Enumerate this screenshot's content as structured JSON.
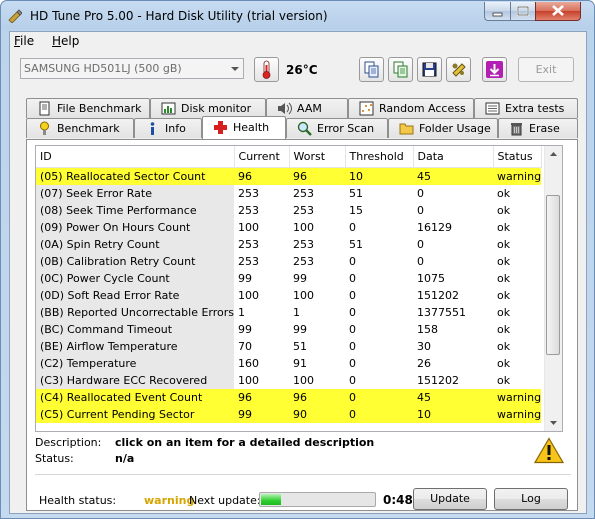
{
  "window": {
    "title": "HD Tune Pro 5.00 - Hard Disk Utility (trial version)"
  },
  "menu": [
    {
      "accel": "F",
      "rest": "ile"
    },
    {
      "accel": "H",
      "rest": "elp"
    }
  ],
  "toolbar": {
    "drive": "SAMSUNG HD501LJ (500 gB)",
    "temperature": "26°C",
    "exit_label": "Exit",
    "icons": [
      "copy-icon",
      "copy-all-icon",
      "save-icon",
      "options-icon",
      "download-icon"
    ]
  },
  "tabs_top": [
    {
      "label": "File Benchmark",
      "icon": "file-benchmark-icon"
    },
    {
      "label": "Disk monitor",
      "icon": "disk-monitor-icon"
    },
    {
      "label": "AAM",
      "icon": "speaker-icon"
    },
    {
      "label": "Random Access",
      "icon": "random-access-icon"
    },
    {
      "label": "Extra tests",
      "icon": "extra-tests-icon"
    }
  ],
  "tabs_bottom": [
    {
      "label": "Benchmark",
      "icon": "benchmark-icon"
    },
    {
      "label": "Info",
      "icon": "info-icon"
    },
    {
      "label": "Health",
      "icon": "health-cross-icon",
      "active": true
    },
    {
      "label": "Error Scan",
      "icon": "error-scan-icon"
    },
    {
      "label": "Folder Usage",
      "icon": "folder-icon"
    },
    {
      "label": "Erase",
      "icon": "trash-icon"
    }
  ],
  "smart": {
    "columns": [
      "ID",
      "Current",
      "Worst",
      "Threshold",
      "Data",
      "Status"
    ],
    "rows": [
      {
        "id": "(05) Reallocated Sector Count",
        "current": "96",
        "worst": "96",
        "threshold": "10",
        "data": "45",
        "status": "warning",
        "warn": true
      },
      {
        "id": "(07) Seek Error Rate",
        "current": "253",
        "worst": "253",
        "threshold": "51",
        "data": "0",
        "status": "ok"
      },
      {
        "id": "(08) Seek Time Performance",
        "current": "253",
        "worst": "253",
        "threshold": "15",
        "data": "0",
        "status": "ok"
      },
      {
        "id": "(09) Power On Hours Count",
        "current": "100",
        "worst": "100",
        "threshold": "0",
        "data": "16129",
        "status": "ok"
      },
      {
        "id": "(0A) Spin Retry Count",
        "current": "253",
        "worst": "253",
        "threshold": "51",
        "data": "0",
        "status": "ok"
      },
      {
        "id": "(0B) Calibration Retry Count",
        "current": "253",
        "worst": "253",
        "threshold": "0",
        "data": "0",
        "status": "ok"
      },
      {
        "id": "(0C) Power Cycle Count",
        "current": "99",
        "worst": "99",
        "threshold": "0",
        "data": "1075",
        "status": "ok"
      },
      {
        "id": "(0D) Soft Read Error Rate",
        "current": "100",
        "worst": "100",
        "threshold": "0",
        "data": "151202",
        "status": "ok"
      },
      {
        "id": "(BB) Reported Uncorrectable Errors",
        "current": "1",
        "worst": "1",
        "threshold": "0",
        "data": "1377551",
        "status": "ok"
      },
      {
        "id": "(BC) Command Timeout",
        "current": "99",
        "worst": "99",
        "threshold": "0",
        "data": "158",
        "status": "ok"
      },
      {
        "id": "(BE) Airflow Temperature",
        "current": "70",
        "worst": "51",
        "threshold": "0",
        "data": "30",
        "status": "ok"
      },
      {
        "id": "(C2) Temperature",
        "current": "160",
        "worst": "91",
        "threshold": "0",
        "data": "26",
        "status": "ok"
      },
      {
        "id": "(C3) Hardware ECC Recovered",
        "current": "100",
        "worst": "100",
        "threshold": "0",
        "data": "151202",
        "status": "ok"
      },
      {
        "id": "(C4) Reallocated Event Count",
        "current": "96",
        "worst": "96",
        "threshold": "0",
        "data": "45",
        "status": "warning",
        "warn": true
      },
      {
        "id": "(C5) Current Pending Sector",
        "current": "99",
        "worst": "90",
        "threshold": "0",
        "data": "10",
        "status": "warning",
        "warn": true
      }
    ]
  },
  "details": {
    "description_label": "Description:",
    "description": "click on an item for a detailed description",
    "status_label": "Status:",
    "status": "n/a"
  },
  "footer": {
    "health_label": "Health status:",
    "health_value": "warning",
    "next_update_label": "Next update:",
    "next_update_progress": 0.18,
    "next_update_time": "0:48",
    "update_button": "Update",
    "log_button": "Log"
  },
  "colors": {
    "warning_row": "#ffff33",
    "warning_text": "#d6a500",
    "progress": "#2fcf2f"
  }
}
